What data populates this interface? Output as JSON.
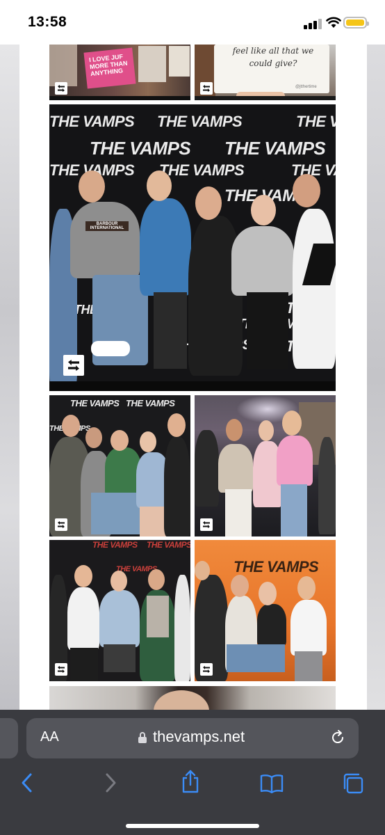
{
  "status_bar": {
    "time": "13:58",
    "signal_icon": "cellular-signal-icon",
    "wifi_icon": "wifi-icon",
    "battery_icon": "battery-icon",
    "battery_color": "#f5c518"
  },
  "gallery": {
    "badge_icon": "photo-swipe-icon",
    "photos": [
      {
        "name": "photo-1",
        "scene": "crowd-signs",
        "sign_text": "I LOVE JUF MORE THAN ANYTHING"
      },
      {
        "name": "photo-2",
        "scene": "handwritten-note",
        "note_text": "feel like all that we could give?",
        "signature": "@jtthertime"
      },
      {
        "name": "photo-3",
        "scene": "backdrop-group",
        "backdrop_logo": "THE VAMPS",
        "shirt_text": "BARBOUR INTERNATIONAL"
      },
      {
        "name": "photo-4",
        "scene": "backdrop-group",
        "backdrop_logo": "THE VAMPS"
      },
      {
        "name": "photo-5",
        "scene": "venue-group"
      },
      {
        "name": "photo-6",
        "scene": "backdrop-group-red",
        "backdrop_logo": "THE VAMPS"
      },
      {
        "name": "photo-7",
        "scene": "orange-backdrop",
        "backdrop_logo": "THE VAMPS"
      },
      {
        "name": "photo-8",
        "scene": "partial-next-photo"
      }
    ]
  },
  "browser": {
    "text_size_label": "AA",
    "lock_icon": "lock-icon",
    "url": "thevamps.net",
    "reload_icon": "reload-icon",
    "back_icon": "back-chevron-icon",
    "forward_icon": "forward-chevron-icon",
    "share_icon": "share-icon",
    "bookmarks_icon": "book-icon",
    "tabs_icon": "tabs-icon",
    "accent_color": "#3b8cf6"
  }
}
